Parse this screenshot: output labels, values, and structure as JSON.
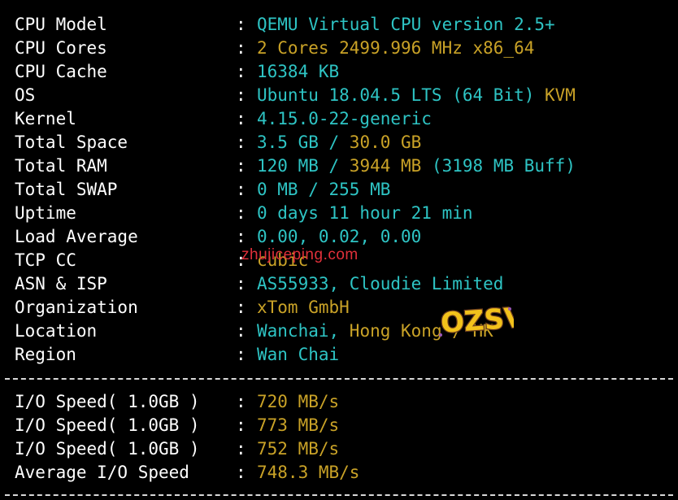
{
  "rows": [
    {
      "label": "CPU Model",
      "colon": ":",
      "parts": [
        {
          "text": "QEMU Virtual CPU version 2.5+",
          "color": "cyan"
        }
      ]
    },
    {
      "label": "CPU Cores",
      "colon": ":",
      "parts": [
        {
          "text": "2 Cores 2499.996 MHz x86_64",
          "color": "yellow"
        }
      ]
    },
    {
      "label": "CPU Cache",
      "colon": ":",
      "parts": [
        {
          "text": "16384 KB",
          "color": "cyan"
        }
      ]
    },
    {
      "label": "OS",
      "colon": ":",
      "parts": [
        {
          "text": "Ubuntu 18.04.5 LTS (64 Bit) ",
          "color": "cyan"
        },
        {
          "text": "KVM",
          "color": "yellow"
        }
      ]
    },
    {
      "label": "Kernel",
      "colon": ":",
      "parts": [
        {
          "text": "4.15.0-22-generic",
          "color": "cyan"
        }
      ]
    },
    {
      "label": "Total Space",
      "colon": ":",
      "parts": [
        {
          "text": "3.5 GB / ",
          "color": "cyan"
        },
        {
          "text": "30.0 GB",
          "color": "yellow"
        }
      ]
    },
    {
      "label": "Total RAM",
      "colon": ":",
      "parts": [
        {
          "text": "120 MB / ",
          "color": "cyan"
        },
        {
          "text": "3944 MB",
          "color": "yellow"
        },
        {
          "text": " (3198 MB Buff)",
          "color": "cyan"
        }
      ]
    },
    {
      "label": "Total SWAP",
      "colon": ":",
      "parts": [
        {
          "text": "0 MB / 255 MB",
          "color": "cyan"
        }
      ]
    },
    {
      "label": "Uptime",
      "colon": ":",
      "parts": [
        {
          "text": "0 days 11 hour 21 min",
          "color": "cyan"
        }
      ]
    },
    {
      "label": "Load Average",
      "colon": ":",
      "parts": [
        {
          "text": "0.00, 0.02, 0.00",
          "color": "cyan"
        }
      ]
    },
    {
      "label": "TCP CC",
      "colon": ":",
      "parts": [
        {
          "text": "cubic",
          "color": "yellow"
        }
      ]
    },
    {
      "label": "ASN & ISP",
      "colon": ":",
      "parts": [
        {
          "text": "AS55933, Cloudie Limited",
          "color": "cyan"
        }
      ]
    },
    {
      "label": "Organization",
      "colon": ":",
      "parts": [
        {
          "text": "xTom GmbH",
          "color": "yellow"
        }
      ]
    },
    {
      "label": "Location",
      "colon": ":",
      "parts": [
        {
          "text": "Wanchai, ",
          "color": "cyan"
        },
        {
          "text": "Hong Kong / HK",
          "color": "yellow"
        }
      ]
    },
    {
      "label": "Region",
      "colon": ":",
      "parts": [
        {
          "text": "Wan Chai",
          "color": "cyan"
        }
      ]
    }
  ],
  "io_rows": [
    {
      "label": "I/O Speed( 1.0GB )",
      "colon": ":",
      "parts": [
        {
          "text": "720 MB/s",
          "color": "yellow"
        }
      ]
    },
    {
      "label": "I/O Speed( 1.0GB )",
      "colon": ":",
      "parts": [
        {
          "text": "773 MB/s",
          "color": "yellow"
        }
      ]
    },
    {
      "label": "I/O Speed( 1.0GB )",
      "colon": ":",
      "parts": [
        {
          "text": "752 MB/s",
          "color": "yellow"
        }
      ]
    },
    {
      "label": "Average I/O Speed",
      "colon": ":",
      "parts": [
        {
          "text": "748.3 MB/s",
          "color": "yellow"
        }
      ]
    }
  ],
  "watermark": {
    "text": "zhujiceping.com"
  },
  "logo": {
    "text": "OZSV"
  },
  "colors": {
    "cyan": "#2ec4c4",
    "yellow": "#c9a227",
    "background": "#000000",
    "foreground": "#ffffff",
    "watermark": "#e0303a"
  }
}
